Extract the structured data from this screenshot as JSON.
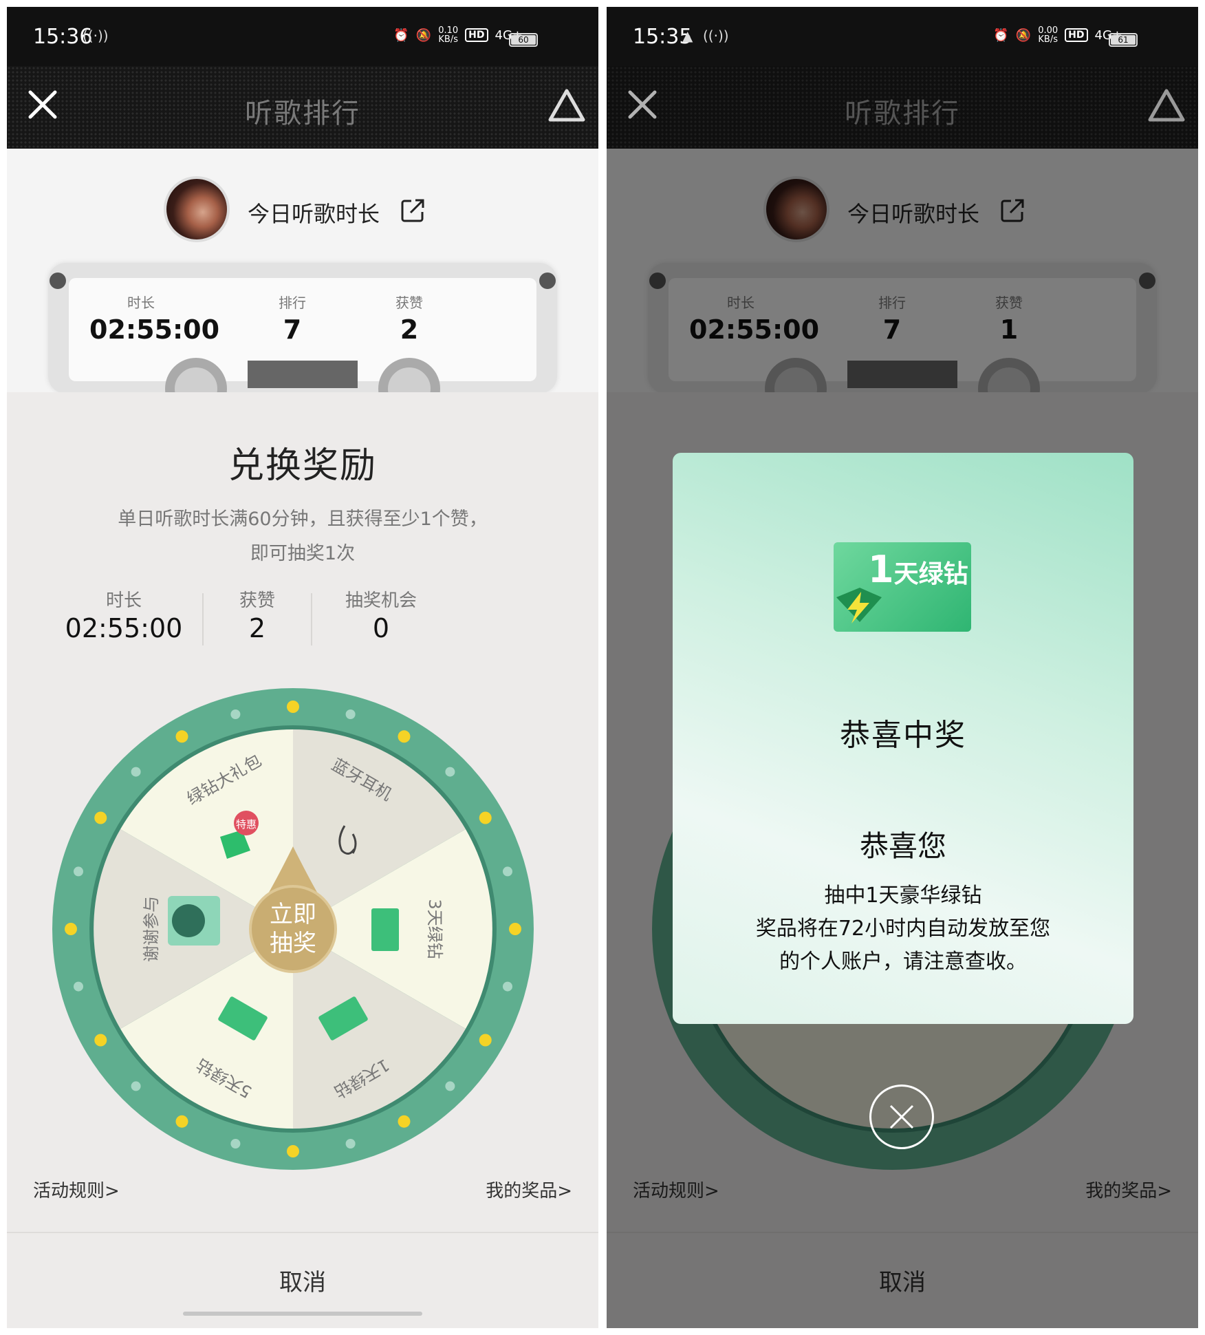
{
  "left": {
    "status_bar": {
      "time": "15:36",
      "net_speed_value": "0.10",
      "net_speed_unit": "KB/s",
      "hd": "HD",
      "network": "4G+",
      "battery": "60"
    },
    "header": {
      "title": "听歌排行"
    },
    "profile": {
      "label": "今日听歌时长"
    },
    "cassette_stats": [
      {
        "label": "时长",
        "value": "02:55:00"
      },
      {
        "label": "排行",
        "value": "7"
      },
      {
        "label": "获赞",
        "value": "2"
      }
    ],
    "sheet": {
      "title": "兑换奖励",
      "description_line1": "单日听歌时长满60分钟，且获得至少1个赞，",
      "description_line2": "即可抽奖1次",
      "stats": [
        {
          "label": "时长",
          "value": "02:55:00"
        },
        {
          "label": "获赞",
          "value": "2"
        },
        {
          "label": "抽奖机会",
          "value": "0"
        }
      ],
      "wheel": {
        "center_line1": "立即",
        "center_line2": "抽奖",
        "badge": "特惠",
        "prizes": [
          "蓝牙耳机",
          "3天绿钻",
          "1天绿钻",
          "5天绿钻",
          "谢谢参与",
          "绿钻大礼包"
        ]
      },
      "rules_link": "活动规则>",
      "prizes_link": "我的奖品>",
      "cancel": "取消"
    }
  },
  "right": {
    "status_bar": {
      "time": "15:35",
      "net_speed_value": "0.00",
      "net_speed_unit": "KB/s",
      "hd": "HD",
      "network": "4G+",
      "battery": "61"
    },
    "header": {
      "title": "听歌排行"
    },
    "profile": {
      "label": "今日听歌时长"
    },
    "cassette_stats": [
      {
        "label": "时长",
        "value": "02:55:00"
      },
      {
        "label": "排行",
        "value": "7"
      },
      {
        "label": "获赞",
        "value": "1"
      }
    ],
    "modal": {
      "card_num": "1",
      "card_text": "天绿钻",
      "heading": "恭喜中奖",
      "subheading": "恭喜您",
      "line1": "抽中1天豪华绿钻",
      "line2": "奖品将在72小时内自动发放至您",
      "line3": "的个人账户，请注意查收。"
    },
    "rules_link": "活动规则>",
    "prizes_link": "我的奖品>",
    "cancel": "取消"
  },
  "colors": {
    "wheel_ring": "#5fae8f",
    "wheel_light": "#f7f7e6",
    "wheel_dark": "#e4e2d8",
    "center_gold": "#cfb378",
    "modal_green": "#9fe1c6"
  }
}
